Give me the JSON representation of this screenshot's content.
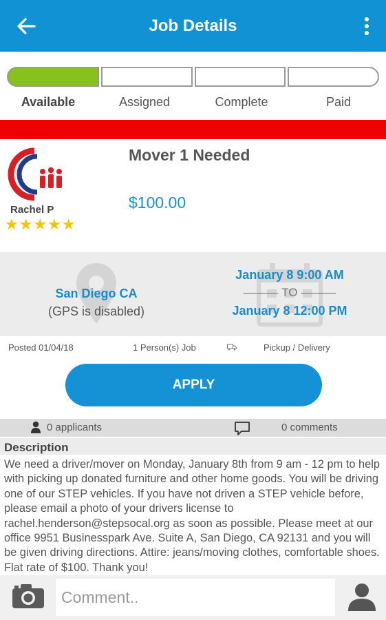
{
  "appbar": {
    "title": "Job Details"
  },
  "progress": {
    "steps": [
      {
        "label": "Available",
        "active": true
      },
      {
        "label": "Assigned",
        "active": false
      },
      {
        "label": "Complete",
        "active": false
      },
      {
        "label": "Paid",
        "active": false
      }
    ],
    "active_color": "#86c11e"
  },
  "job": {
    "poster": "Rachel P",
    "rating": 5,
    "stars": "★★★★★",
    "title": "Mover 1 Needed",
    "pay": "$100.00"
  },
  "location": {
    "city": "San Diego CA",
    "gps": "(GPS is disabled)"
  },
  "schedule": {
    "start": "January 8 9:00 AM",
    "to": "——— TO ———",
    "end": "January 8 12:00 PM"
  },
  "meta": {
    "posted": "Posted 01/04/18",
    "persons": "1 Person(s) Job",
    "type": "Pickup / Delivery"
  },
  "actions": {
    "apply": "APPLY"
  },
  "stats": {
    "applicants": "0 applicants",
    "comments": "0 comments"
  },
  "description": {
    "title": "Description",
    "body": "We need a driver/mover on Monday, January 8th from 9 am - 12 pm to help with picking up donated furniture and other home goods. You will be driving one of our STEP vehicles. If you have not driven a STEP vehicle before, please email a photo of your drivers license to rachel.henderson@stepsocal.org as soon as possible. Please meet at our office 9951 Businesspark Ave. Suite A, San Diego, CA 92131 and you will be given driving directions. Attire: jeans/moving clothes, comfortable shoes. Flat rate of $100. Thank you!"
  },
  "comment": {
    "placeholder": "Comment.."
  },
  "colors": {
    "primary": "#1192d4",
    "alert": "#ee0000",
    "accent": "#86c11e",
    "star": "#f2c400"
  },
  "icons": [
    "back-arrow-icon",
    "more-vert-icon",
    "location-pin-icon",
    "calendar-icon",
    "truck-icon",
    "person-icon",
    "comment-icon",
    "camera-icon",
    "avatar-icon"
  ]
}
